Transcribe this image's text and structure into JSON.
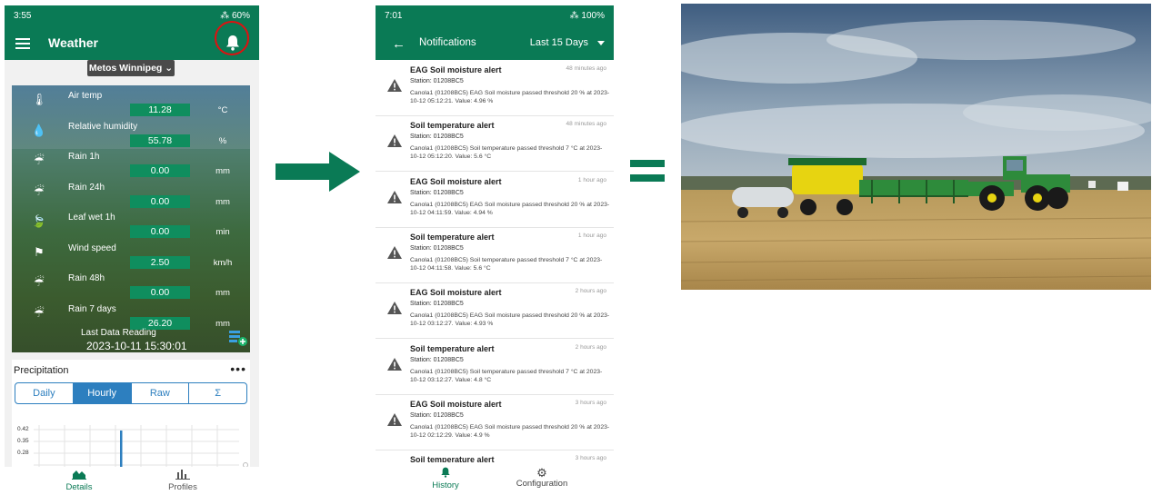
{
  "phone1": {
    "status": {
      "time": "3:55",
      "battery": "60%"
    },
    "appbar": {
      "title": "Weather",
      "icon": "bell-icon"
    },
    "station_selector": "Metos Winnipeg",
    "sensors": [
      {
        "name": "Air temp",
        "value": "11.28",
        "unit": "°C",
        "icon": "thermometer-icon"
      },
      {
        "name": "Relative humidity",
        "value": "55.78",
        "unit": "%",
        "icon": "humidity-icon"
      },
      {
        "name": "Rain 1h",
        "value": "0.00",
        "unit": "mm",
        "icon": "rain-icon"
      },
      {
        "name": "Rain 24h",
        "value": "0.00",
        "unit": "mm",
        "icon": "rain-icon"
      },
      {
        "name": "Leaf wet 1h",
        "value": "0.00",
        "unit": "min",
        "icon": "leaf-icon"
      },
      {
        "name": "Wind speed",
        "value": "2.50",
        "unit": "km/h",
        "icon": "windsock-icon"
      },
      {
        "name": "Rain 48h",
        "value": "0.00",
        "unit": "mm",
        "icon": "rain-icon"
      },
      {
        "name": "Rain 7 days",
        "value": "26.20",
        "unit": "mm",
        "icon": "rain-icon"
      }
    ],
    "last_reading_label": "Last Data Reading",
    "last_reading_value": "2023-10-11 15:30:01",
    "precipitation": {
      "title": "Precipitation",
      "menu": "•••",
      "tabs": [
        "Daily",
        "Hourly",
        "Raw",
        "Σ"
      ],
      "active_tab": "Hourly",
      "y_ticks": [
        "0.42",
        "0.35",
        "0.28"
      ]
    },
    "nav": [
      {
        "label": "Details",
        "icon": "chart-area-icon",
        "active": true
      },
      {
        "label": "Profiles",
        "icon": "bar-chart-icon",
        "active": false
      }
    ]
  },
  "phone2": {
    "status": {
      "time": "7:01",
      "battery": "100%"
    },
    "appbar": {
      "title": "Notifications",
      "period": "Last 15 Days"
    },
    "notifications": [
      {
        "title": "EAG Soil moisture alert",
        "time": "48 minutes ago",
        "station": "Station: 01208BC5",
        "message": "Canola1 (01208BC5) EAG Soil moisture passed threshold 20 % at 2023-10-12 05:12:21. Value: 4.96 %"
      },
      {
        "title": "Soil temperature alert",
        "time": "48 minutes ago",
        "station": "Station: 01208BC5",
        "message": "Canola1 (01208BC5) Soil temperature passed threshold 7 °C at 2023-10-12 05:12:20. Value: 5.6 °C"
      },
      {
        "title": "EAG Soil moisture alert",
        "time": "1 hour ago",
        "station": "Station: 01208BC5",
        "message": "Canola1 (01208BC5) EAG Soil moisture passed threshold 20 % at 2023-10-12 04:11:59. Value: 4.94 %"
      },
      {
        "title": "Soil temperature alert",
        "time": "1 hour ago",
        "station": "Station: 01208BC5",
        "message": "Canola1 (01208BC5) Soil temperature passed threshold 7 °C at 2023-10-12 04:11:58. Value: 5.6 °C"
      },
      {
        "title": "EAG Soil moisture alert",
        "time": "2 hours ago",
        "station": "Station: 01208BC5",
        "message": "Canola1 (01208BC5) EAG Soil moisture passed threshold 20 % at 2023-10-12 03:12:27. Value: 4.93 %"
      },
      {
        "title": "Soil temperature alert",
        "time": "2 hours ago",
        "station": "Station: 01208BC5",
        "message": "Canola1 (01208BC5) Soil temperature passed threshold 7 °C at 2023-10-12 03:12:27. Value: 4.8 °C"
      },
      {
        "title": "EAG Soil moisture alert",
        "time": "3 hours ago",
        "station": "Station: 01208BC5",
        "message": "Canola1 (01208BC5) EAG Soil moisture passed threshold 20 % at 2023-10-12 02:12:29. Value: 4.9 %"
      },
      {
        "title": "Soil temperature alert",
        "time": "3 hours ago",
        "station": "",
        "message": ""
      }
    ],
    "nav": [
      {
        "label": "History",
        "icon": "bell-icon",
        "active": true
      },
      {
        "label": "Configuration",
        "icon": "gear-icon",
        "active": false
      }
    ]
  },
  "colors": {
    "brand_green": "#0a7a55",
    "value_green": "#0f8e5e",
    "tab_blue": "#2d7fbf",
    "highlight_red": "#e01010"
  }
}
